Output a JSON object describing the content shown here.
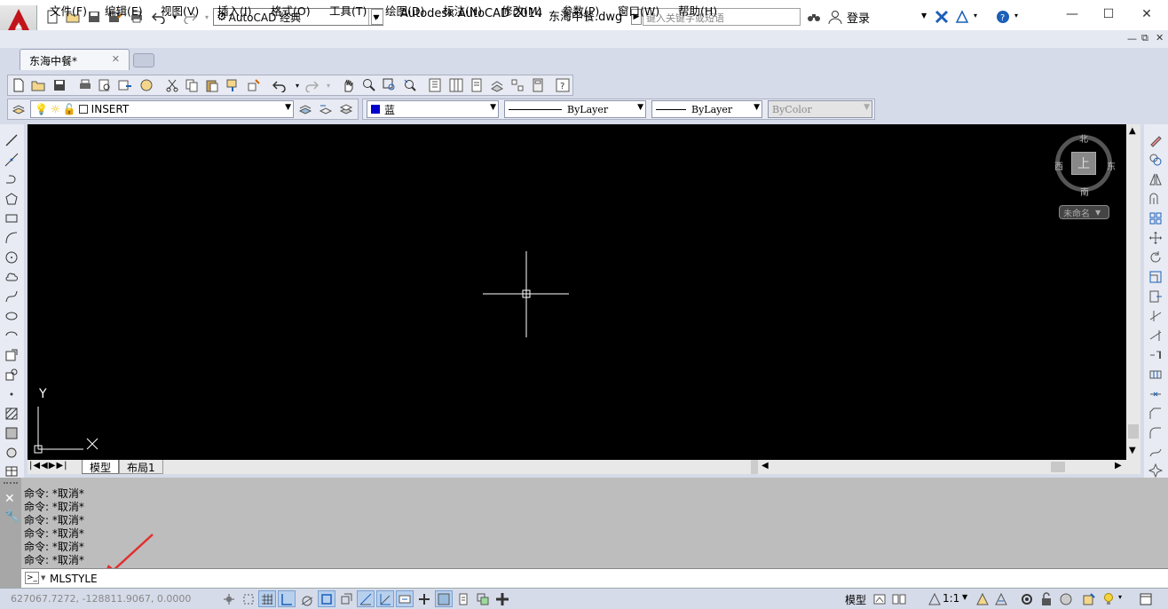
{
  "title": {
    "app": "Autodesk AutoCAD 2014",
    "file": "东海中餐.dwg",
    "workspace": "AutoCAD 经典",
    "search_placeholder": "键入关键字或短语",
    "login": "登录"
  },
  "menu": [
    "文件(F)",
    "编辑(E)",
    "视图(V)",
    "插入(I)",
    "格式(O)",
    "工具(T)",
    "绘图(D)",
    "标注(N)",
    "修改(M)",
    "参数(P)",
    "窗口(W)",
    "帮助(H)"
  ],
  "tabs": {
    "active": "东海中餐*"
  },
  "properties": {
    "layer": "INSERT",
    "color": "蓝",
    "linetype": "ByLayer",
    "lineweight": "ByLayer",
    "plotstyle": "ByColor",
    "color_hex": "#0000cc"
  },
  "viewcube": {
    "north": "北",
    "south": "南",
    "east": "东",
    "west": "西",
    "top": "上",
    "wcs": "未命名"
  },
  "ucs": {
    "y": "Y"
  },
  "layout_tabs": [
    "模型",
    "布局1"
  ],
  "command": {
    "history": [
      "命令: *取消*",
      "命令: *取消*",
      "命令: *取消*",
      "命令: *取消*",
      "命令: *取消*",
      "命令: *取消*"
    ],
    "input": "MLSTYLE"
  },
  "status": {
    "coords": "627067.7272, -128811.9067, 0.0000",
    "model": "模型",
    "scale": "1:1"
  }
}
